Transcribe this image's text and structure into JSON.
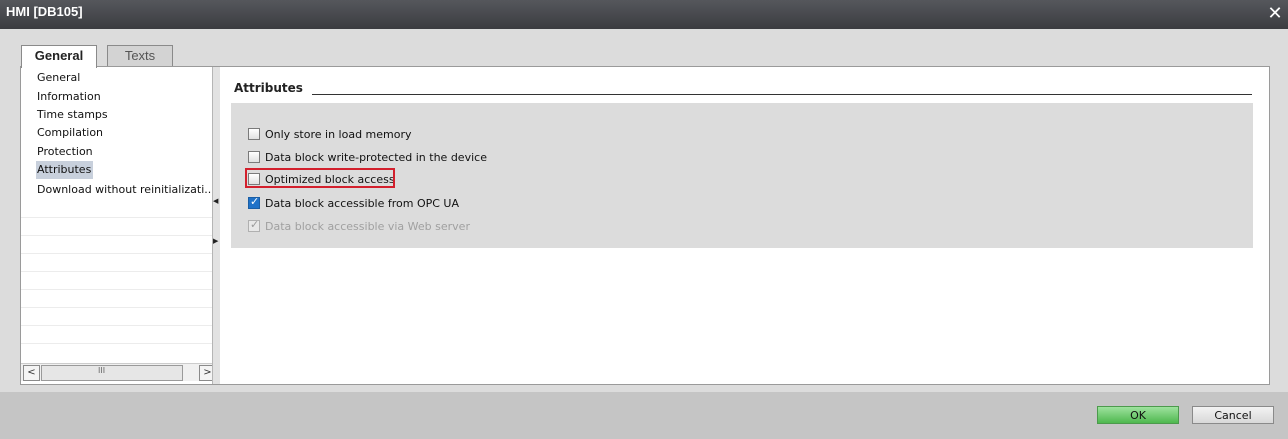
{
  "window": {
    "title": "HMI [DB105]",
    "close_glyph": "✕"
  },
  "tabs": [
    {
      "label": "General",
      "selected": true
    },
    {
      "label": "Texts",
      "selected": false
    }
  ],
  "nav": {
    "items": [
      {
        "label": "General"
      },
      {
        "label": "Information"
      },
      {
        "label": "Time stamps"
      },
      {
        "label": "Compilation"
      },
      {
        "label": "Protection"
      },
      {
        "label": "Attributes",
        "selected": true
      },
      {
        "label": "Download without reinitializati..."
      }
    ],
    "scroll_left": "<",
    "scroll_right": ">",
    "scroll_grip": "III"
  },
  "splitter": {
    "arrow_left": "◀",
    "arrow_right": "▶"
  },
  "main": {
    "section_title": "Attributes",
    "options": [
      {
        "label": "Only store in load memory",
        "checked": false,
        "enabled": true
      },
      {
        "label": "Data block write-protected in the device",
        "checked": false,
        "enabled": true
      },
      {
        "label": "Optimized block access",
        "checked": false,
        "enabled": true,
        "highlighted": true
      },
      {
        "label": "Data block accessible from OPC UA",
        "checked": true,
        "enabled": true
      },
      {
        "label": "Data block accessible via Web server",
        "checked": true,
        "enabled": false
      }
    ]
  },
  "footer": {
    "ok_label": "OK",
    "cancel_label": "Cancel"
  },
  "colors": {
    "ok_button": "#4fb84f",
    "highlight_box": "#d3202d",
    "selected_nav": "#c8d0dc",
    "checkbox_checked": "#1f72c8"
  }
}
